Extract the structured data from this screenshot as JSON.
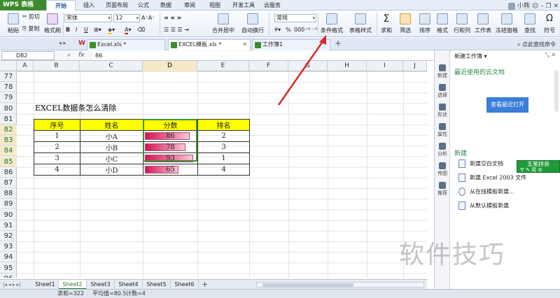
{
  "app": {
    "logo": "WPS 表格",
    "user": "小熊"
  },
  "menu": {
    "items": [
      "开始",
      "插入",
      "页面布局",
      "公式",
      "数据",
      "审阅",
      "视图",
      "开发工具",
      "云服务"
    ],
    "active": "开始"
  },
  "ribbon": {
    "paste": "粘贴",
    "cut": "剪切",
    "copy": "复制",
    "format_painter": "格式刷",
    "font_name": "宋体",
    "font_size": "12",
    "bold": "B",
    "italic": "I",
    "underline": "U",
    "merge_center": "合并居中",
    "wrap_text": "自动换行",
    "number_format": "常规",
    "percent": "%",
    "conditional_format": "条件格式",
    "table_style": "表格样式",
    "sum": "求和",
    "filter": "筛选",
    "sort": "排序",
    "format": "格式",
    "row_col": "行和列",
    "worksheet": "工作表",
    "freeze": "冻结窗格",
    "find": "查找",
    "symbol": "符号"
  },
  "tabs": [
    {
      "label": "Excel.xls *",
      "active": false
    },
    {
      "label": "EXCEL模板.xls *",
      "active": true
    },
    {
      "label": "工作簿1",
      "active": false
    }
  ],
  "formula": {
    "namebox": "D82",
    "value": "86",
    "fx": "fx"
  },
  "columns": [
    "A",
    "B",
    "C",
    "D",
    "E",
    "F",
    "G",
    "H",
    "I",
    "J"
  ],
  "rows": [
    "77",
    "78",
    "79",
    "80",
    "81",
    "82",
    "83",
    "84",
    "85",
    "86",
    "87",
    "88",
    "89",
    "90",
    "91",
    "92",
    "93",
    "94",
    "95",
    "96",
    "97"
  ],
  "title_cell": "EXCEL数据条怎么清除",
  "table": {
    "headers": [
      "序号",
      "姓名",
      "分数",
      "排名"
    ],
    "rows": [
      {
        "no": "1",
        "name": "小A",
        "score": "86",
        "rank": "2",
        "fill": 0.86
      },
      {
        "no": "2",
        "name": "小B",
        "score": "78",
        "rank": "3",
        "fill": 0.78
      },
      {
        "no": "3",
        "name": "小C",
        "score": "93",
        "rank": "1",
        "fill": 0.93
      },
      {
        "no": "4",
        "name": "小D",
        "score": "65",
        "rank": "4",
        "fill": 0.65
      }
    ]
  },
  "sheets": [
    "Sheet1",
    "Sheet2",
    "Sheet3",
    "Sheet4",
    "Sheet5",
    "Sheet6"
  ],
  "active_sheet": "Sheet2",
  "status": {
    "sum": "求和=322",
    "avg": "平均值=80.5",
    "count": "计数=4"
  },
  "task_pane": {
    "title": "新建工作簿 ▾",
    "recent": "最近使用的云文档",
    "open_recent": "查看最近打开",
    "new": "新建",
    "items": [
      "新建空白文档",
      "新建 Excel 2003 文件",
      "从在线模板新建...",
      "从默认模板新建"
    ],
    "top_right": "点此查找命令"
  },
  "side_tools": [
    "新建",
    "选择",
    "形状",
    "属性",
    "分析",
    "传图",
    "推荐"
  ],
  "ime": {
    "label": "五笔拼音",
    "icons": "⛛ ✎ 简 ⚙"
  },
  "watermark": "软件技巧",
  "colors": {
    "accent": "#3d8b2e",
    "header_fill": "#ffff00",
    "bar": "#d4145a",
    "select": "#3c8f3c"
  }
}
